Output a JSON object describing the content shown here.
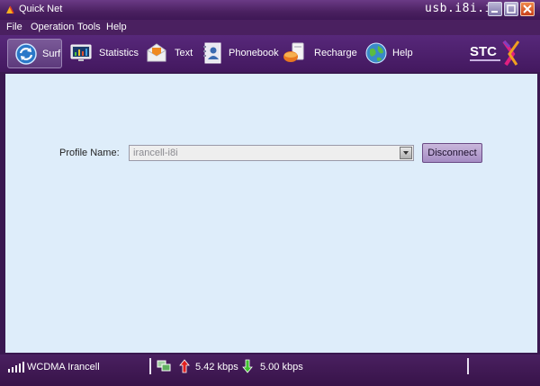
{
  "window": {
    "title": "Quick Net",
    "url_watermark": "usb.i8i.ir"
  },
  "menu": [
    "File",
    "Operation",
    "Tools",
    "Help"
  ],
  "toolbar": {
    "active": "Surf",
    "items": [
      {
        "label": "Surf",
        "icon": "surf-refresh-icon"
      },
      {
        "label": "Statistics",
        "icon": "statistics-monitor-icon"
      },
      {
        "label": "Text",
        "icon": "text-envelope-icon"
      },
      {
        "label": "Phonebook",
        "icon": "phonebook-icon"
      },
      {
        "label": "Recharge",
        "icon": "recharge-icon"
      },
      {
        "label": "Help",
        "icon": "help-globe-icon"
      }
    ],
    "brand": "STC"
  },
  "main": {
    "profile_label": "Profile Name:",
    "profile_value": "irancell-i8i",
    "disconnect_label": "Disconnect"
  },
  "status": {
    "network_type": "WCDMA",
    "operator": "Irancell",
    "network_text": "WCDMA  Irancell",
    "upload_speed": "5.42 kbps",
    "download_speed": "5.00 kbps"
  },
  "colors": {
    "chrome": "#4a2060",
    "content_bg": "#deedfa",
    "button_bg": "#b39ad0"
  }
}
